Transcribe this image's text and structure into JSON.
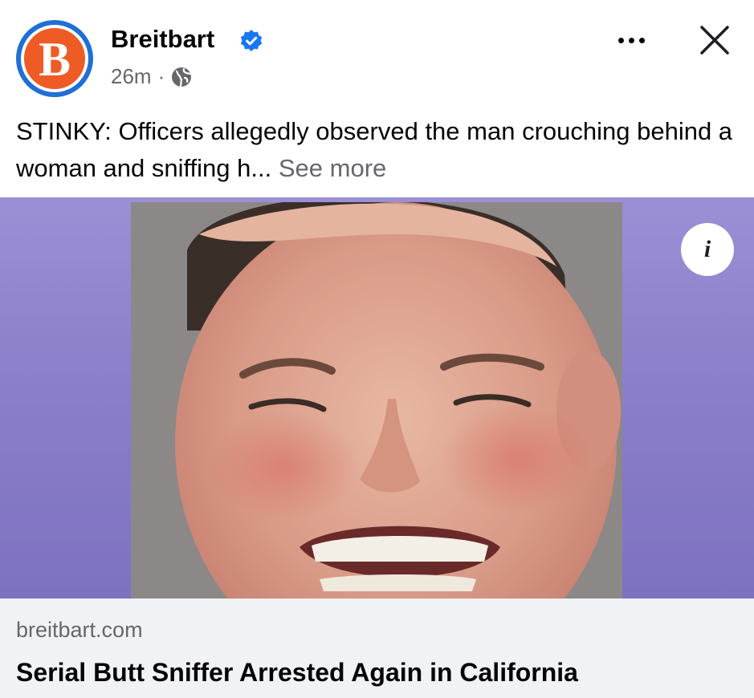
{
  "post": {
    "page_name": "Breitbart",
    "avatar_letter": "B",
    "time": "26m",
    "separator": "·",
    "caption": "STINKY: Officers allegedly observed the man crouching behind a woman and sniffing h...",
    "see_more": "See more"
  },
  "icons": {
    "verified": "verified-badge-icon",
    "audience": "globe-icon",
    "more": "more-options-icon",
    "close": "close-icon",
    "info": "info-icon"
  },
  "info_label": "i",
  "link": {
    "domain": "breitbart.com",
    "headline": "Serial Butt Sniffer Arrested Again in California"
  },
  "colors": {
    "brand_orange": "#ef5b24",
    "brand_blue": "#1f6fd6",
    "verified_blue": "#1877f2",
    "secondary_text": "#65676b",
    "media_background": "#8b7fcb",
    "preview_background": "#f0f2f5"
  }
}
